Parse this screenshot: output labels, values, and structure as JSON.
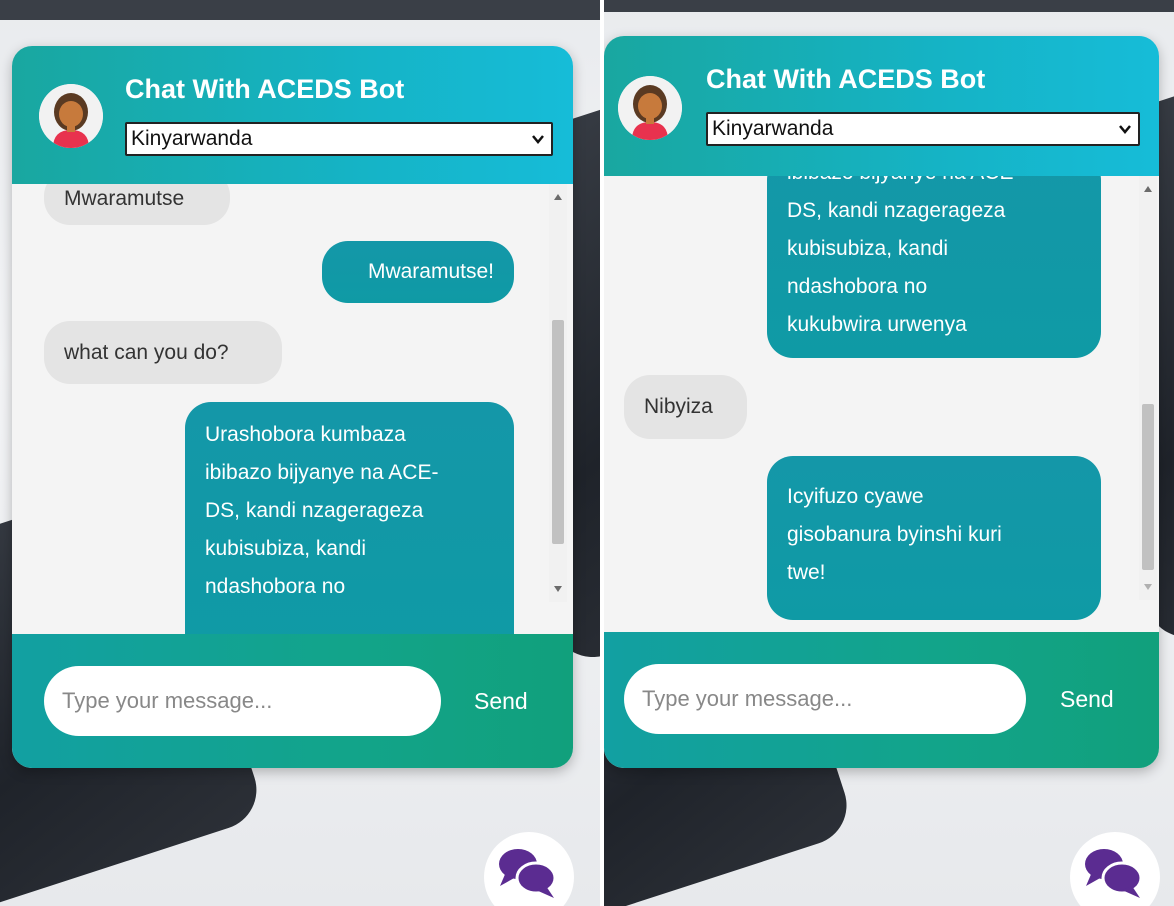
{
  "left": {
    "header": {
      "title": "Chat With ACEDS Bot",
      "language": "Kinyarwanda"
    },
    "messages": [
      {
        "from": "bot",
        "lines": [
          "Mwaramutse"
        ]
      },
      {
        "from": "user",
        "lines": [
          "Mwaramutse!"
        ]
      },
      {
        "from": "bot",
        "lines": [
          "what can you do?"
        ]
      },
      {
        "from": "user",
        "lines": [
          "Urashobora kumbaza",
          "ibibazo bijyanye na ACE-",
          "DS, kandi nzagerageza",
          "kubisubiza, kandi",
          "ndashobora no"
        ]
      }
    ],
    "footer": {
      "placeholder": "Type your message...",
      "send_label": "Send"
    }
  },
  "right": {
    "header": {
      "title": "Chat With ACEDS Bot",
      "language": "Kinyarwanda"
    },
    "messages": [
      {
        "from": "user",
        "lines": [
          "ibibazo bijyanye na ACE-",
          "DS, kandi nzagerageza",
          "kubisubiza, kandi",
          "ndashobora no",
          "kukubwira urwenya"
        ]
      },
      {
        "from": "bot",
        "lines": [
          "Nibyiza"
        ]
      },
      {
        "from": "user",
        "lines": [
          "Icyifuzo cyawe",
          "gisobanura byinshi kuri",
          "twe!"
        ]
      }
    ],
    "footer": {
      "placeholder": "Type your message...",
      "send_label": "Send"
    }
  },
  "icons": {
    "avatar": "woman-avatar-icon",
    "chat_toggle": "chat-bubbles-icon",
    "select": "chevron-down-icon"
  },
  "colors": {
    "header_start": "#19a7a0",
    "header_end": "#16bcd8",
    "footer": "#12a48a",
    "user_bubble": "#1497a8",
    "bot_bubble": "#e4e4e4",
    "chat_icon": "#5b2c91"
  }
}
